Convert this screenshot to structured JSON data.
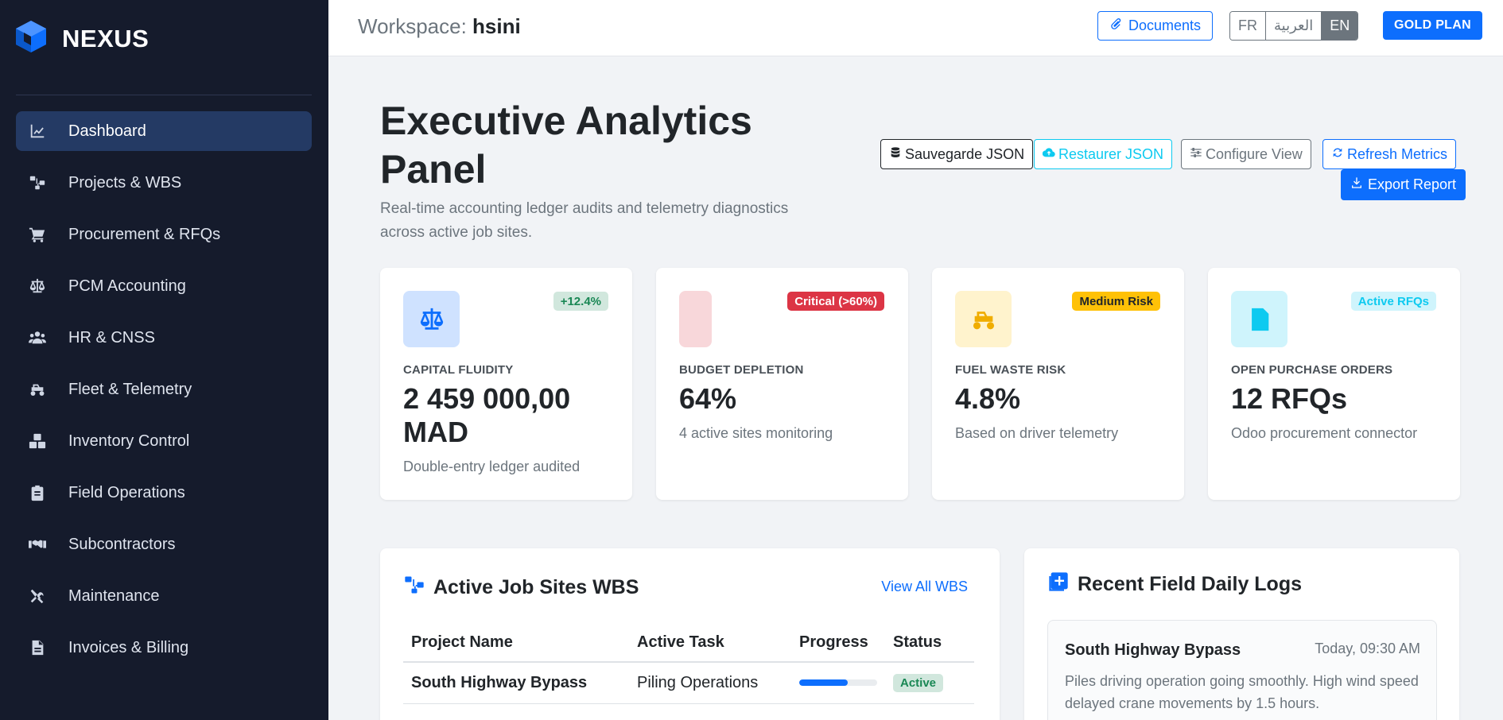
{
  "app": {
    "name": "NEXUS"
  },
  "sidebar": {
    "items": [
      {
        "label": "Dashboard",
        "icon": "chart-line-icon",
        "active": true
      },
      {
        "label": "Projects & WBS",
        "icon": "sitemap-icon"
      },
      {
        "label": "Procurement & RFQs",
        "icon": "shopping-cart-icon"
      },
      {
        "label": "PCM Accounting",
        "icon": "scale-balance-icon"
      },
      {
        "label": "HR & CNSS",
        "icon": "users-icon"
      },
      {
        "label": "Fleet & Telemetry",
        "icon": "truck-monster-icon"
      },
      {
        "label": "Inventory Control",
        "icon": "boxes-icon"
      },
      {
        "label": "Field Operations",
        "icon": "clipboard-icon"
      },
      {
        "label": "Subcontractors",
        "icon": "handshake-icon"
      },
      {
        "label": "Maintenance",
        "icon": "tools-icon"
      },
      {
        "label": "Invoices & Billing",
        "icon": "file-invoice-icon"
      }
    ]
  },
  "topbar": {
    "workspace_label": "Workspace:",
    "workspace_name": "hsini",
    "documents_label": "Documents",
    "languages": [
      "FR",
      "العربية",
      "EN"
    ],
    "active_language": "EN",
    "plan_label": "GOLD PLAN"
  },
  "header": {
    "title": "Executive Analytics Panel",
    "subtitle": "Real-time accounting ledger audits and telemetry diagnostics across active job sites.",
    "buttons": {
      "backup": "Sauvegarde JSON",
      "restore": "Restaurer JSON",
      "configure": "Configure View",
      "refresh": "Refresh Metrics",
      "export": "Export Report"
    }
  },
  "kpis": [
    {
      "label": "CAPITAL FLUIDITY",
      "value": "2 459 000,00 MAD",
      "desc": "Double-entry ledger audited",
      "badge": "+12.4%",
      "icon": "scale-balance-icon"
    },
    {
      "label": "BUDGET DEPLETION",
      "value": "64%",
      "desc": "4 active sites monitoring",
      "badge": "Critical (>60%)",
      "icon": ""
    },
    {
      "label": "FUEL WASTE RISK",
      "value": "4.8%",
      "desc": "Based on driver telemetry",
      "badge": "Medium Risk",
      "icon": "truck-monster-icon"
    },
    {
      "label": "OPEN PURCHASE ORDERS",
      "value": "12 RFQs",
      "desc": "Odoo procurement connector",
      "badge": "Active RFQs",
      "icon": "file-invoice-dollar-icon"
    }
  ],
  "colors": {
    "sidebar_bg": "#151b2c",
    "accent": "#0d6efd",
    "danger": "#dc3545",
    "warning": "#ffc107",
    "info": "#0dcaf0",
    "success": "#198754"
  },
  "wbs": {
    "title": "Active Job Sites WBS",
    "view_all": "View All WBS",
    "columns": [
      "Project Name",
      "Active Task",
      "Progress",
      "Status"
    ],
    "rows": [
      {
        "project": "South Highway Bypass",
        "task": "Piling Operations",
        "progress": 0.62,
        "status": "Active"
      }
    ]
  },
  "logs": {
    "title": "Recent Field Daily Logs",
    "entries": [
      {
        "site": "South Highway Bypass",
        "time": "Today, 09:30 AM",
        "text": "Piles driving operation going smoothly. High wind speed delayed crane movements by 1.5 hours."
      }
    ]
  }
}
